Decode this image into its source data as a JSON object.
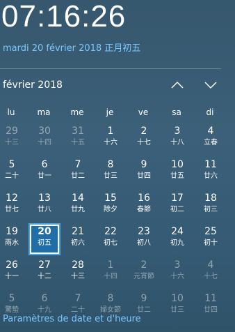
{
  "clock": {
    "time": "07:16:26"
  },
  "date_line": "mardi 20 février 2018 正月初五",
  "calendar": {
    "month_label": "février 2018",
    "nav": {
      "up_icon": "chevron-up-icon",
      "down_icon": "chevron-down-icon"
    },
    "weekdays": [
      "lu",
      "ma",
      "me",
      "je",
      "ve",
      "sa",
      "di"
    ],
    "weeks": [
      [
        {
          "day": "29",
          "lunar": "十三",
          "month": "other"
        },
        {
          "day": "30",
          "lunar": "十四",
          "month": "other"
        },
        {
          "day": "31",
          "lunar": "十五",
          "month": "other"
        },
        {
          "day": "1",
          "lunar": "十六",
          "month": "current"
        },
        {
          "day": "2",
          "lunar": "十七",
          "month": "current"
        },
        {
          "day": "3",
          "lunar": "十八",
          "month": "current"
        },
        {
          "day": "4",
          "lunar": "立春",
          "month": "current"
        }
      ],
      [
        {
          "day": "5",
          "lunar": "二十",
          "month": "current"
        },
        {
          "day": "6",
          "lunar": "廿一",
          "month": "current"
        },
        {
          "day": "7",
          "lunar": "廿二",
          "month": "current"
        },
        {
          "day": "8",
          "lunar": "廿三",
          "month": "current"
        },
        {
          "day": "9",
          "lunar": "廿四",
          "month": "current"
        },
        {
          "day": "10",
          "lunar": "廿五",
          "month": "current"
        },
        {
          "day": "11",
          "lunar": "廿六",
          "month": "current"
        }
      ],
      [
        {
          "day": "12",
          "lunar": "廿七",
          "month": "current"
        },
        {
          "day": "13",
          "lunar": "廿八",
          "month": "current"
        },
        {
          "day": "14",
          "lunar": "廿九",
          "month": "current"
        },
        {
          "day": "15",
          "lunar": "除夕",
          "month": "current"
        },
        {
          "day": "16",
          "lunar": "春節",
          "month": "current"
        },
        {
          "day": "17",
          "lunar": "初二",
          "month": "current"
        },
        {
          "day": "18",
          "lunar": "初三",
          "month": "current"
        }
      ],
      [
        {
          "day": "19",
          "lunar": "雨水",
          "month": "current"
        },
        {
          "day": "20",
          "lunar": "初五",
          "month": "current",
          "today": true
        },
        {
          "day": "21",
          "lunar": "初六",
          "month": "current"
        },
        {
          "day": "22",
          "lunar": "初七",
          "month": "current"
        },
        {
          "day": "23",
          "lunar": "初八",
          "month": "current"
        },
        {
          "day": "24",
          "lunar": "初九",
          "month": "current"
        },
        {
          "day": "25",
          "lunar": "初十",
          "month": "current"
        }
      ],
      [
        {
          "day": "26",
          "lunar": "十一",
          "month": "current"
        },
        {
          "day": "27",
          "lunar": "十二",
          "month": "current"
        },
        {
          "day": "28",
          "lunar": "十三",
          "month": "current"
        },
        {
          "day": "1",
          "lunar": "十四",
          "month": "other"
        },
        {
          "day": "2",
          "lunar": "元宵節",
          "month": "other"
        },
        {
          "day": "3",
          "lunar": "十六",
          "month": "other"
        },
        {
          "day": "4",
          "lunar": "十七",
          "month": "other"
        }
      ],
      [
        {
          "day": "5",
          "lunar": "驚蟄",
          "month": "other"
        },
        {
          "day": "6",
          "lunar": "十九",
          "month": "other"
        },
        {
          "day": "7",
          "lunar": "二十",
          "month": "other"
        },
        {
          "day": "8",
          "lunar": "婦女節",
          "month": "other"
        },
        {
          "day": "9",
          "lunar": "廿二",
          "month": "other"
        },
        {
          "day": "10",
          "lunar": "廿三",
          "month": "other"
        },
        {
          "day": "11",
          "lunar": "廿四",
          "month": "other"
        }
      ]
    ]
  },
  "settings_link": "Paramètres de date et d'heure",
  "colors": {
    "accent": "#7cc7ff",
    "today_fill": "#1f6ea8",
    "today_border": "#4aa3e6"
  }
}
